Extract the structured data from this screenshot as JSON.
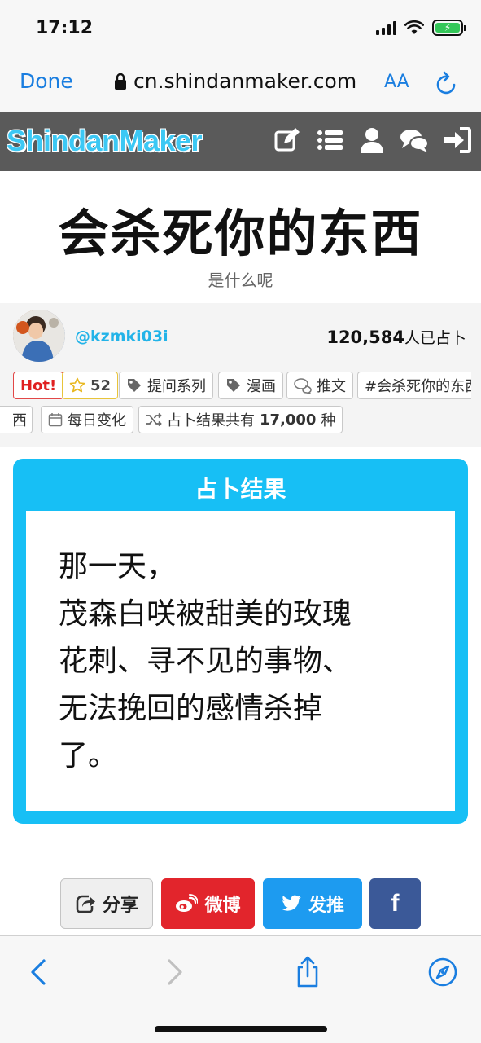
{
  "status": {
    "time": "17:12"
  },
  "browser": {
    "done_label": "Done",
    "url": "cn.shindanmaker.com",
    "text_size_label": "AA",
    "icons": [
      "lock-icon",
      "reload-icon",
      "back-icon",
      "forward-icon",
      "share-icon",
      "compass-icon"
    ]
  },
  "site": {
    "logo": "ShindanMaker",
    "nav_icons": [
      "edit-icon",
      "list-icon",
      "user-icon",
      "chat-icon",
      "login-icon"
    ]
  },
  "page": {
    "title": "会杀死你的东西",
    "subtitle": "是什么呢"
  },
  "meta": {
    "author": "@kzmki03i",
    "count": "120,584",
    "count_suffix": "人已占卜",
    "tags": {
      "hot": "Hot!",
      "stars": "52",
      "tag1": "提问系列",
      "tag2": "漫画",
      "tweet": "推文",
      "hashtag": "#会杀死你的东西",
      "daily": "每日变化",
      "results_prefix": "占卜结果共有",
      "results_count": "17,000",
      "results_suffix": "种"
    }
  },
  "result": {
    "heading": "占卜结果",
    "lines": [
      "那一天，",
      "茂森白咲被甜美的玫瑰",
      "花刺、寻不见的事物、",
      "无法挽回的感情杀掉",
      "了。"
    ]
  },
  "share": {
    "share_label": "分享",
    "weibo_label": "微博",
    "tweet_label": "发推",
    "fb_label": "f"
  },
  "colors": {
    "accent_blue": "#17bff5",
    "link_blue": "#1a7ee0",
    "header_gray": "#5a5a5a",
    "weibo_red": "#e2252c",
    "twitter_blue": "#1d9bf0",
    "facebook_blue": "#3b5998"
  }
}
